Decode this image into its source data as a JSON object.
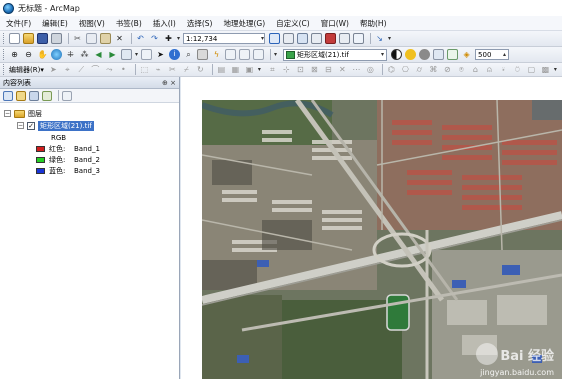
{
  "window": {
    "title": "无标题 - ArcMap"
  },
  "menu": {
    "items": [
      "文件(F)",
      "编辑(E)",
      "视图(V)",
      "书签(B)",
      "插入(I)",
      "选择(S)",
      "地理处理(G)",
      "自定义(C)",
      "窗口(W)",
      "帮助(H)"
    ]
  },
  "toolbar": {
    "scale": "1:12,734",
    "active_layer": "矩形区域(21).tif",
    "numeric_value": "500",
    "editor_label": "编辑器(R)▾"
  },
  "toc": {
    "title": "内容列表",
    "controls": "⊕ ×",
    "group_name": "图层",
    "layer_name": "矩形区域(21).tif",
    "render_type": "RGB",
    "bands": [
      {
        "channel": "红色:",
        "band": "Band_1",
        "color": "#d01e1e"
      },
      {
        "channel": "绿色:",
        "band": "Band_2",
        "color": "#25cf25"
      },
      {
        "channel": "蓝色:",
        "band": "Band_3",
        "color": "#1a35d6"
      }
    ]
  },
  "watermark": {
    "text": "Bai 经验",
    "url": "jingyan.baidu.com"
  }
}
